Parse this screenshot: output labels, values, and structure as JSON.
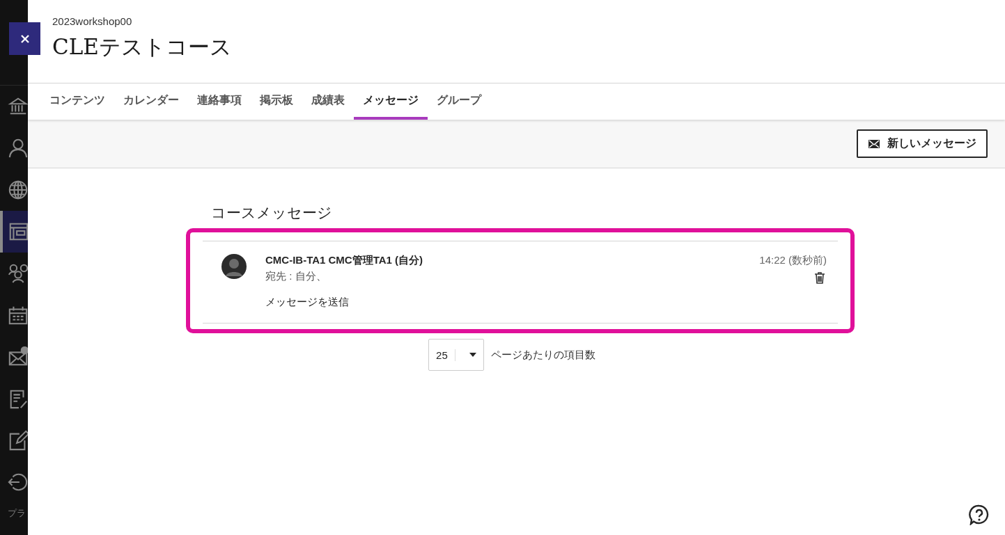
{
  "sidebar": {
    "items": [
      {
        "kind": "institution",
        "selected": false
      },
      {
        "kind": "profile",
        "selected": false
      },
      {
        "kind": "globe",
        "selected": false
      },
      {
        "kind": "courses",
        "selected": true
      },
      {
        "kind": "groups",
        "selected": false
      },
      {
        "kind": "calendar",
        "selected": false
      },
      {
        "kind": "mail",
        "selected": false
      },
      {
        "kind": "grades",
        "selected": false
      },
      {
        "kind": "tools",
        "selected": false
      },
      {
        "kind": "signout",
        "selected": false
      }
    ],
    "footer_text": "プラ"
  },
  "course": {
    "code": "2023workshop00",
    "title": "CLEテストコース"
  },
  "tabs": [
    {
      "label": "コンテンツ",
      "selected": false
    },
    {
      "label": "カレンダー",
      "selected": false
    },
    {
      "label": "連絡事項",
      "selected": false
    },
    {
      "label": "掲示板",
      "selected": false
    },
    {
      "label": "成績表",
      "selected": false
    },
    {
      "label": "メッセージ",
      "selected": true
    },
    {
      "label": "グループ",
      "selected": false
    }
  ],
  "toolbar": {
    "new_message_button": "新しいメッセージ"
  },
  "section_title": "コースメッセージ",
  "messages": [
    {
      "sender": "CMC-IB-TA1 CMC管理TA1 (自分)",
      "recipients": "宛先 : 自分、",
      "body": "メッセージを送信",
      "time": "14:22 (数秒前)",
      "highlighted": true
    }
  ],
  "pagination": {
    "page_size": "25",
    "label": "ページあたりの項目数"
  }
}
